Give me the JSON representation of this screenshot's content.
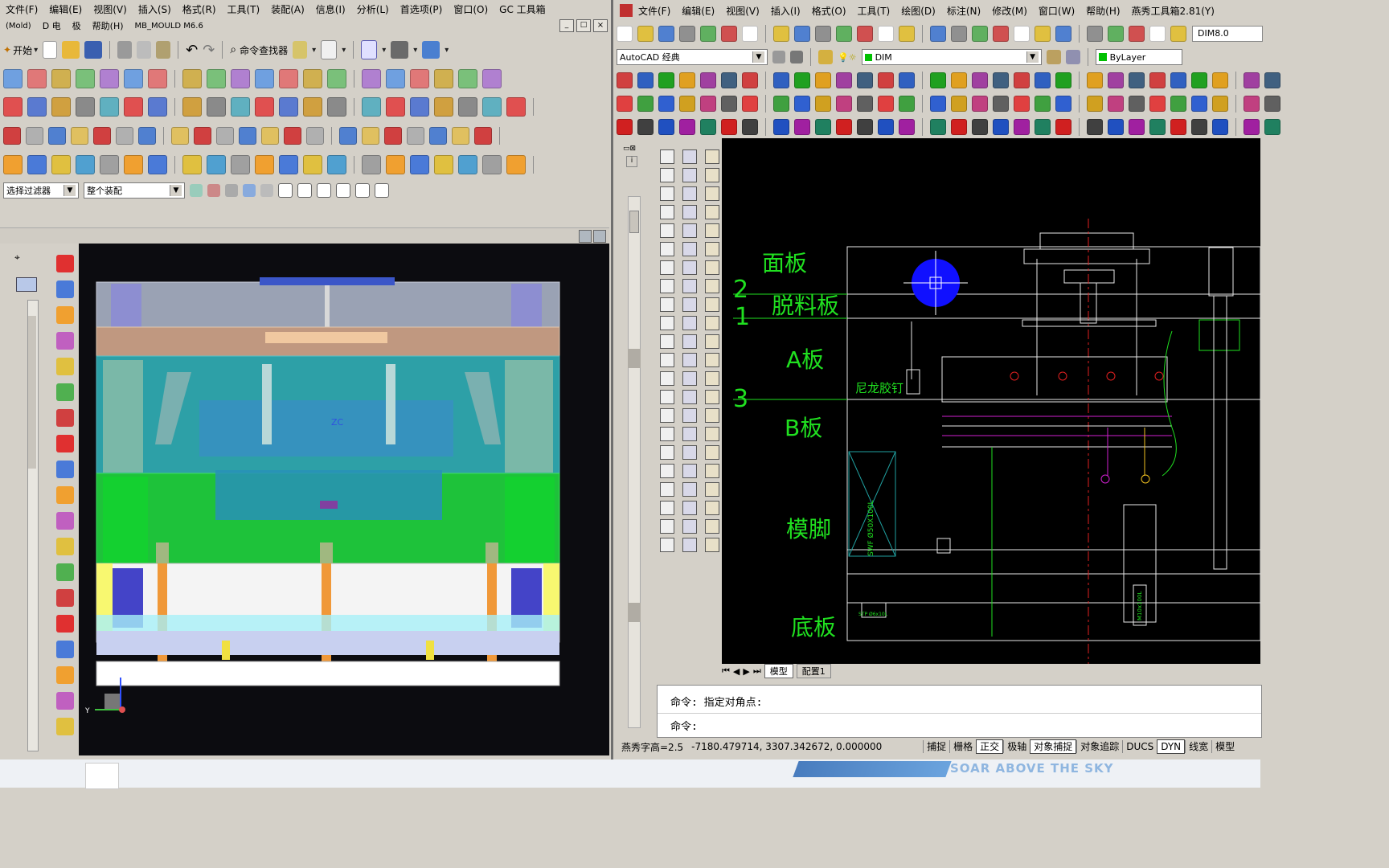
{
  "nx": {
    "menu": [
      "文件(F)",
      "编辑(E)",
      "视图(V)",
      "插入(S)",
      "格式(R)",
      "工具(T)",
      "装配(A)",
      "信息(I)",
      "分析(L)",
      "首选项(P)",
      "窗口(O)",
      "GC 工具箱"
    ],
    "menu2": [
      "(Mold)",
      "D 电",
      "极",
      "帮助(H)",
      "MB_MOULD M6.6"
    ],
    "start_label": "开始",
    "command_finder": "命令查找器",
    "select_filter": "选择过滤器",
    "assembly_scope": "整个装配",
    "triad_labels": {
      "z": "Z",
      "y": "Y",
      "zc": "ZC"
    },
    "win_buttons": [
      "_",
      "□",
      "×"
    ]
  },
  "acad": {
    "menu": [
      "文件(F)",
      "编辑(E)",
      "视图(V)",
      "插入(I)",
      "格式(O)",
      "工具(T)",
      "绘图(D)",
      "标注(N)",
      "修改(M)",
      "窗口(W)",
      "帮助(H)",
      "燕秀工具箱2.81(Y)"
    ],
    "workspace": "AutoCAD 经典",
    "layer": "DIM",
    "color": "ByLayer",
    "dimstyle": "DIM8.0",
    "labels": {
      "panel": "面板",
      "stripper": "脱料板",
      "a_plate": "A板",
      "b_plate": "B板",
      "leg": "模脚",
      "bottom": "底板",
      "nylon": "尼龙胶钉",
      "n2": "2",
      "n1": "1",
      "n3": "3",
      "spring_text": "SWF Ø50X100L",
      "stp_text": "STP Ø6x10L",
      "bolt_text": "M10x100L"
    },
    "tabs": [
      "模型",
      "配置1"
    ],
    "command_lines": [
      "命令: 指定对角点:",
      "命令:"
    ],
    "status": {
      "text_height": "燕秀字高=2.5",
      "coords": "-7180.479714,  3307.342672,  0.000000",
      "toggles": [
        "捕捉",
        "栅格",
        "正交",
        "极轴",
        "对象捕捉",
        "对象追踪",
        "DUCS",
        "DYN",
        "线宽",
        "模型"
      ]
    }
  },
  "watermark": {
    "tagline": "SOAR ABOVE THE SKY"
  }
}
